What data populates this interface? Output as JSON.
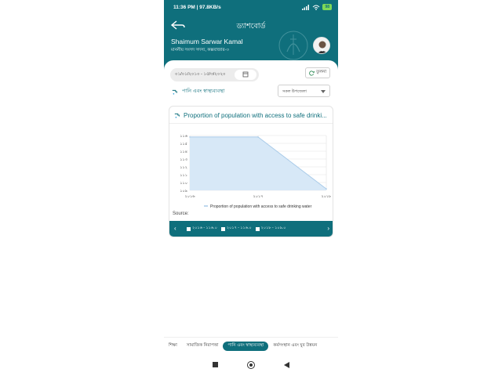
{
  "status_bar": {
    "time_speed": "11:36 PM | 97.8KB/s",
    "battery": "98"
  },
  "header": {
    "title": "ড্যাশবোর্ড",
    "user_name": "Shaimum Sarwar Kamal",
    "user_subtitle": "মাননীয় সংসদ সদস্য, কক্সবাজার-৩"
  },
  "filters": {
    "date_range": "০১/০১/২০১০ - ১৫/৩/২০২০",
    "compare_label": "তুলনা",
    "sector_label": "পানি এবং স্বাস্থ্যব্যবস্থা",
    "upazila_select": "সকল উপজেলা"
  },
  "card": {
    "title": "Proportion of population with access to safe drinki...",
    "source_label": "Source:",
    "legend_nav": [
      "২০১৬ - ১১৬.০",
      "২০১৭ - ১১৬.০",
      "২০১৮ - ১০৯.০"
    ]
  },
  "chart_data": {
    "type": "area",
    "x": [
      "২০১৬",
      "২০১৭",
      "২০১৮"
    ],
    "series": [
      {
        "name": "Proportion of population with access to safe drinking water",
        "values": [
          116,
          116,
          109
        ]
      }
    ],
    "y_ticks": [
      "১১৬",
      "১১৫",
      "১১৪",
      "১১৩",
      "১১২",
      "১১১",
      "১১০",
      "১০৯"
    ],
    "ylim": [
      108.8,
      116.2
    ],
    "grid": true,
    "legend_position": "bottom",
    "colors": {
      "fill": "#d7e8f7",
      "line": "#a9cbe9"
    }
  },
  "bottom_tabs": [
    {
      "label": "শিক্ষা",
      "active": false
    },
    {
      "label": "সামাজিক নিরাপত্তা",
      "active": false
    },
    {
      "label": "পানি এবং স্বাস্থ্যব্যবস্থা",
      "active": true
    },
    {
      "label": "কর্মসংস্থান এবং যুব উন্নয়ন",
      "active": false
    }
  ],
  "colors": {
    "primary": "#0f6f7c",
    "battery": "#7ed957"
  }
}
